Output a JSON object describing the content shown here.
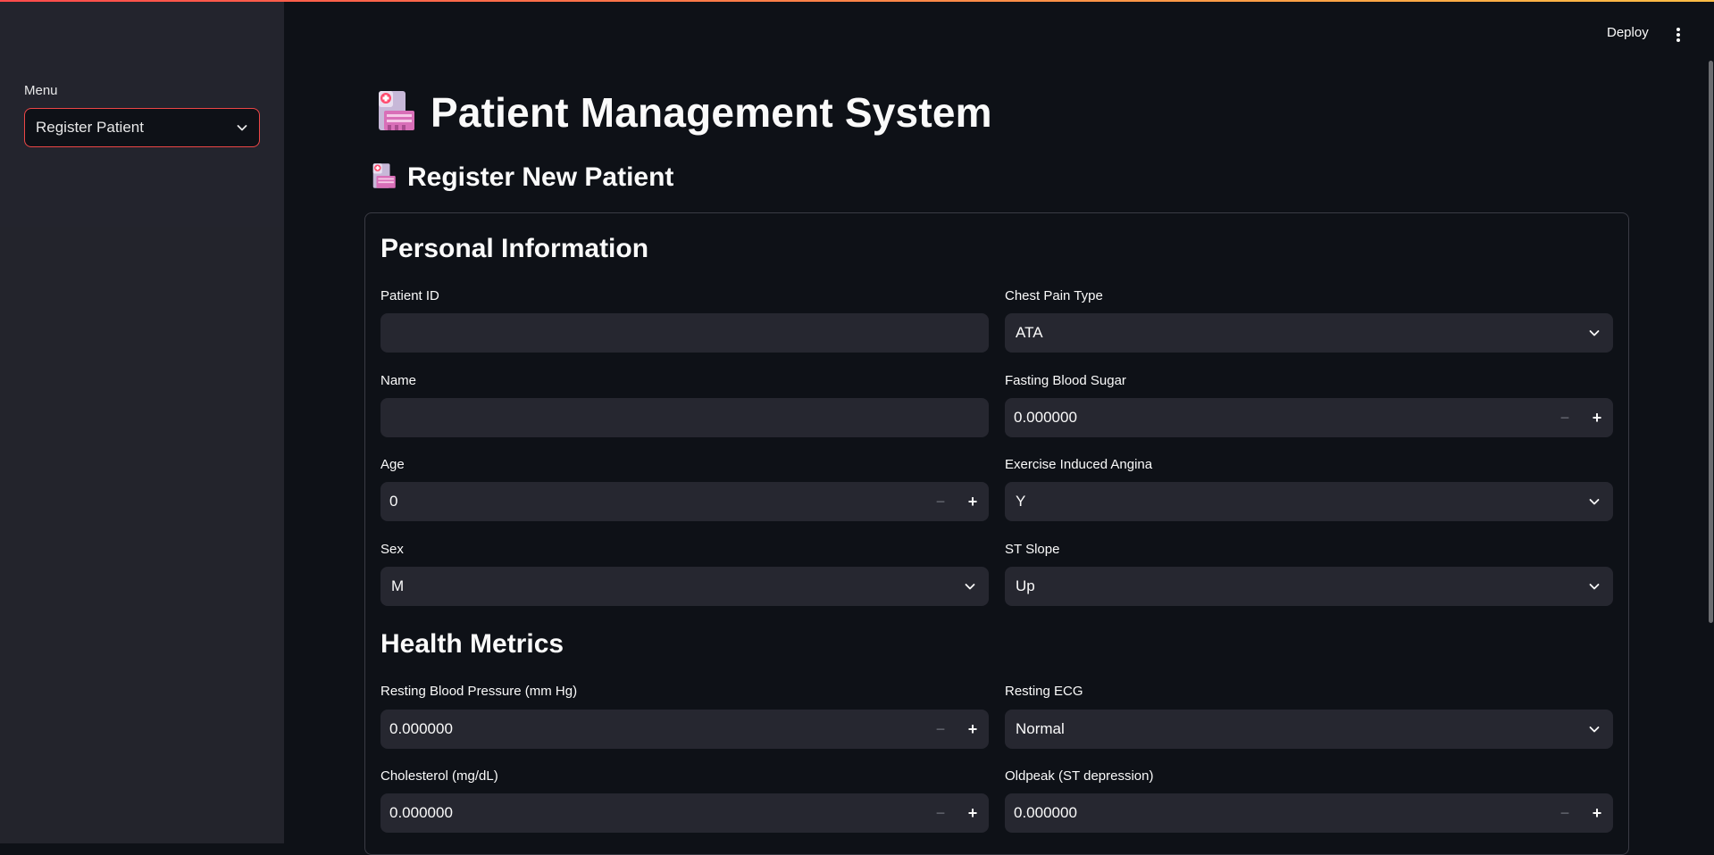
{
  "header": {
    "deploy_label": "Deploy"
  },
  "sidebar": {
    "menu_label": "Menu",
    "menu_selected": "Register Patient"
  },
  "main": {
    "title": "Patient Management System",
    "subtitle": "Register New Patient"
  },
  "personal": {
    "heading": "Personal Information",
    "patient_id": {
      "label": "Patient ID",
      "value": ""
    },
    "name": {
      "label": "Name",
      "value": ""
    },
    "age": {
      "label": "Age",
      "value": "0"
    },
    "sex": {
      "label": "Sex",
      "value": "M"
    },
    "chest_pain": {
      "label": "Chest Pain Type",
      "value": "ATA"
    },
    "fasting_bs": {
      "label": "Fasting Blood Sugar",
      "value": "0.000000"
    },
    "exercise_angina": {
      "label": "Exercise Induced Angina",
      "value": "Y"
    },
    "st_slope": {
      "label": "ST Slope",
      "value": "Up"
    }
  },
  "health": {
    "heading": "Health Metrics",
    "resting_bp": {
      "label": "Resting Blood Pressure (mm Hg)",
      "value": "0.000000"
    },
    "cholesterol": {
      "label": "Cholesterol (mg/dL)",
      "value": "0.000000"
    },
    "resting_ecg": {
      "label": "Resting ECG",
      "value": "Normal"
    },
    "oldpeak": {
      "label": "Oldpeak (ST depression)",
      "value": "0.000000"
    }
  },
  "icons": {
    "title_icon": "hospital-icon",
    "subtitle_icon": "hospital-icon",
    "select_arrow": "chevron-down-icon",
    "menu": "kebab-menu-icon",
    "decrement": "minus-icon",
    "increment": "plus-icon"
  },
  "colors": {
    "background": "#0e1117",
    "sidebar": "#25262f",
    "input": "#262730",
    "accent": "#ff4b4b",
    "text": "#fafafa"
  }
}
